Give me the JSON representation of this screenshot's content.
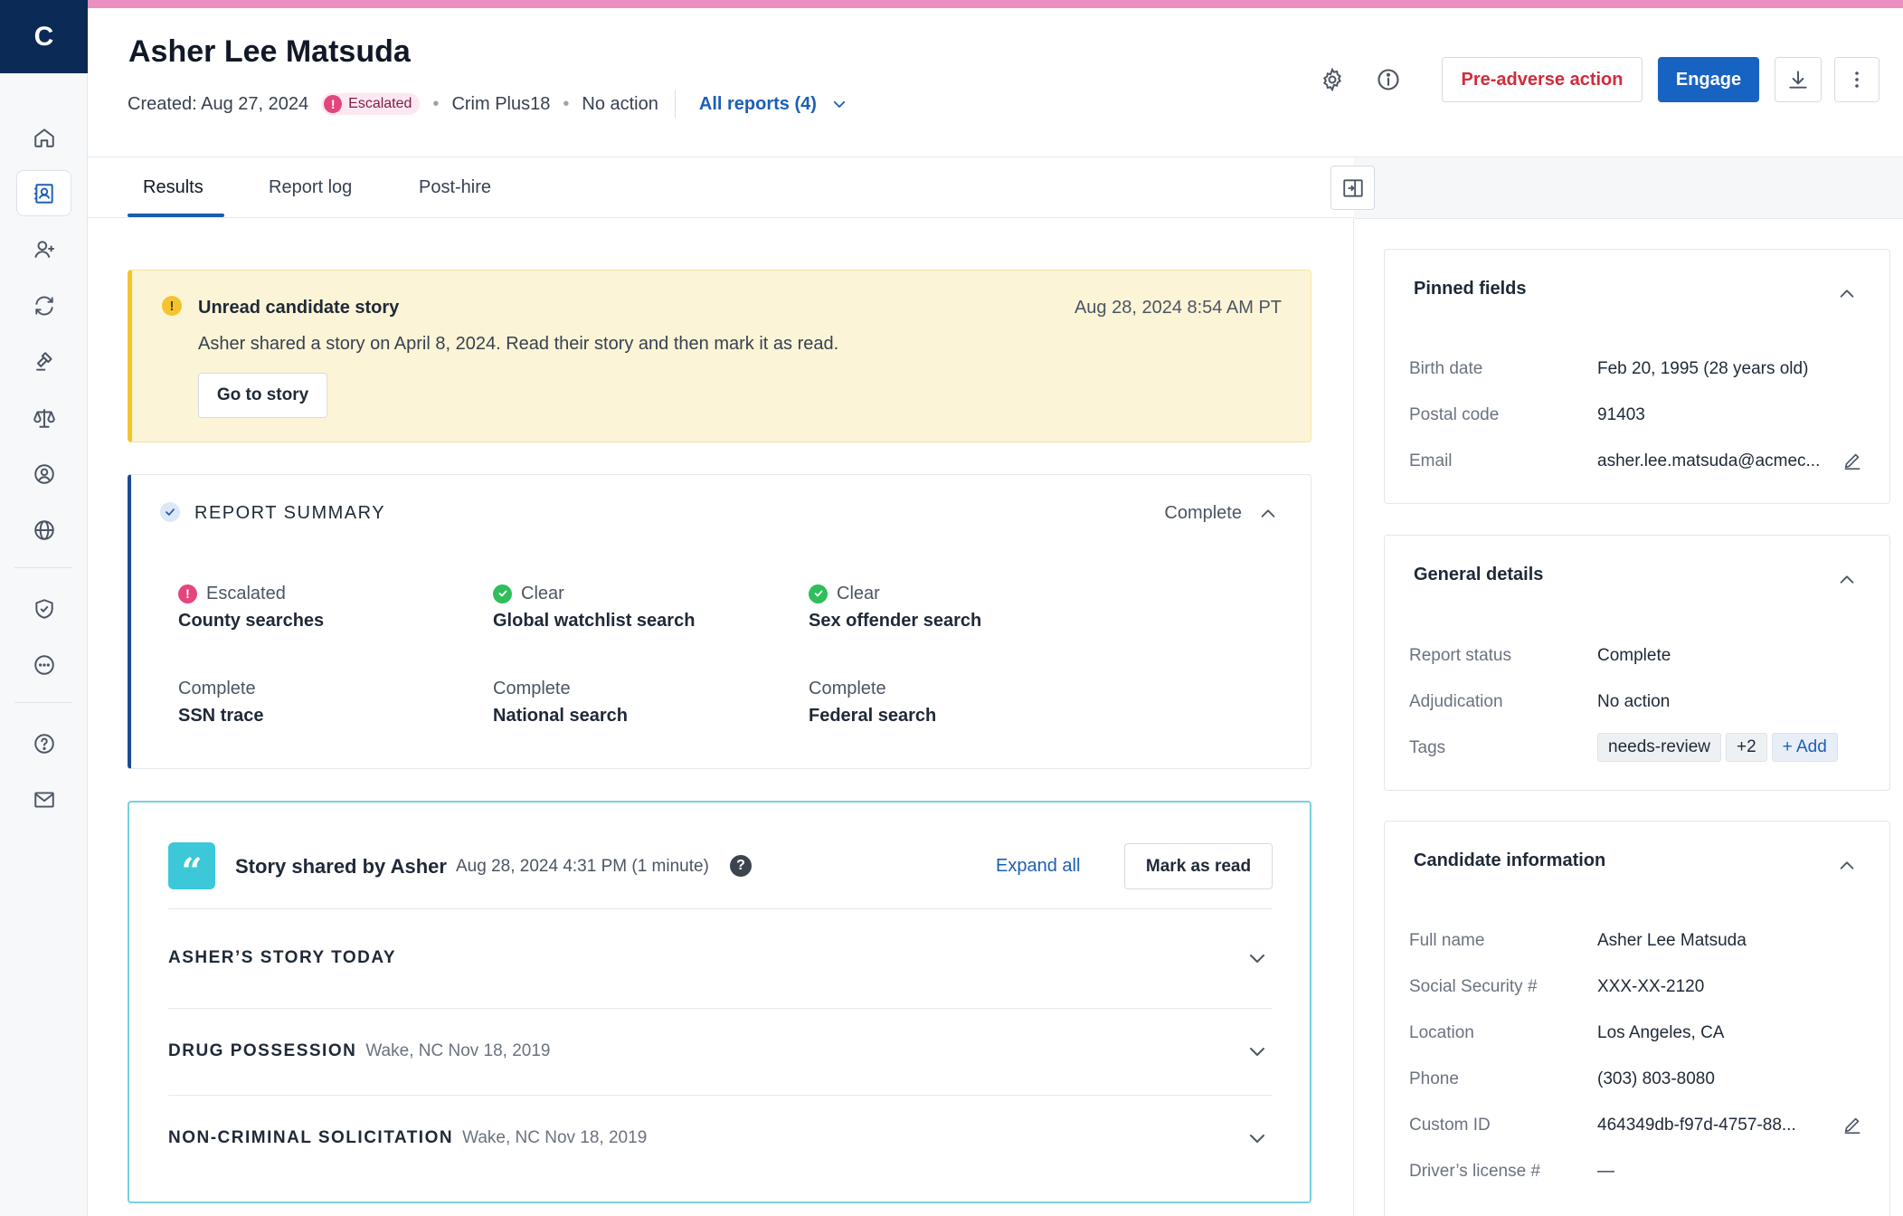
{
  "app": {
    "logo_letter": "C"
  },
  "sidebar": {
    "items": [
      {
        "name": "home-icon"
      },
      {
        "name": "candidate-card-icon",
        "active": true
      },
      {
        "name": "add-user-icon"
      },
      {
        "name": "refresh-icon"
      },
      {
        "name": "gavel-icon"
      },
      {
        "name": "scale-icon"
      },
      {
        "name": "target-user-icon"
      },
      {
        "name": "globe-icon"
      },
      {
        "name": "shield-check-icon"
      },
      {
        "name": "more-circle-icon"
      },
      {
        "name": "help-icon"
      },
      {
        "name": "mail-icon"
      }
    ]
  },
  "header": {
    "candidate_name": "Asher Lee Matsuda",
    "created": "Created: Aug 27, 2024",
    "status_badge": "Escalated",
    "package": "Crim Plus18",
    "adjudication": "No action",
    "all_reports": "All reports (4)",
    "pre_adverse_label": "Pre-adverse action",
    "engage_label": "Engage"
  },
  "tabs": [
    {
      "label": "Results",
      "active": true
    },
    {
      "label": "Report log"
    },
    {
      "label": "Post-hire"
    }
  ],
  "alert": {
    "title": "Unread candidate story",
    "timestamp": "Aug 28, 2024 8:54 AM PT",
    "body": "Asher shared a story on April 8, 2024. Read their story and then mark it as read.",
    "button": "Go to story"
  },
  "report_summary": {
    "title": "REPORT SUMMARY",
    "status": "Complete",
    "items": [
      {
        "status": "Escalated",
        "name": "County searches",
        "kind": "escalated"
      },
      {
        "status": "Clear",
        "name": "Global watchlist search",
        "kind": "clear"
      },
      {
        "status": "Clear",
        "name": "Sex offender search",
        "kind": "clear"
      },
      {
        "status": "Complete",
        "name": "SSN trace",
        "kind": "complete"
      },
      {
        "status": "Complete",
        "name": "National search",
        "kind": "complete"
      },
      {
        "status": "Complete",
        "name": "Federal search",
        "kind": "complete"
      }
    ]
  },
  "story": {
    "quote_glyph": "“",
    "title": "Story shared by Asher",
    "timestamp": "Aug 28, 2024 4:31 PM (1 minute)",
    "help_glyph": "?",
    "expand_all": "Expand all",
    "mark_read": "Mark as read",
    "sections": [
      {
        "title": "ASHER’S STORY TODAY",
        "meta": ""
      },
      {
        "title": "DRUG POSSESSION",
        "meta": "Wake, NC Nov 18, 2019"
      },
      {
        "title": "NON-CRIMINAL SOLICITATION",
        "meta": "Wake, NC Nov 18, 2019"
      }
    ]
  },
  "pinned_fields": {
    "title": "Pinned fields",
    "rows": [
      {
        "label": "Birth date",
        "value": "Feb 20, 1995 (28 years old)"
      },
      {
        "label": "Postal code",
        "value": "91403"
      },
      {
        "label": "Email",
        "value": "asher.lee.matsuda@acmec...",
        "editable": true
      }
    ]
  },
  "general_details": {
    "title": "General details",
    "rows": [
      {
        "label": "Report status",
        "value": "Complete"
      },
      {
        "label": "Adjudication",
        "value": "No action"
      }
    ],
    "tags_label": "Tags",
    "tags": [
      "needs-review",
      "+2"
    ],
    "add_tag": "+  Add"
  },
  "candidate_information": {
    "title": "Candidate information",
    "rows": [
      {
        "label": "Full name",
        "value": "Asher Lee Matsuda"
      },
      {
        "label": "Social Security #",
        "value": "XXX-XX-2120"
      },
      {
        "label": "Location",
        "value": "Los Angeles, CA"
      },
      {
        "label": "Phone",
        "value": "(303) 803-8080"
      },
      {
        "label": "Custom ID",
        "value": "464349db-f97d-4757-88...",
        "editable": true
      },
      {
        "label": "Driver’s license #",
        "value": "—"
      }
    ]
  },
  "colors": {
    "brand_navy": "#0b2a55",
    "primary_blue": "#1763c2",
    "danger_red": "#d22b3b",
    "escalated_pink": "#e2467f",
    "clear_green": "#2fbe5b",
    "story_teal": "#3cc8d8",
    "alert_yellow": "#fcf4d6"
  }
}
